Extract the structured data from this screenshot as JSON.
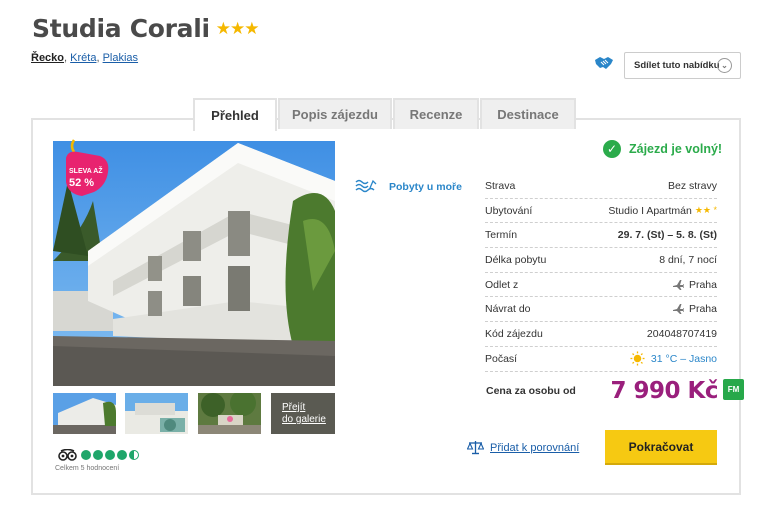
{
  "hotel": {
    "name": "Studia Corali",
    "stars": "★★★"
  },
  "breadcrumb": {
    "country": "Řecko",
    "region": "Kréta",
    "city": "Plakias",
    "sep": ", "
  },
  "share": {
    "label": "Sdílet tuto nabídku",
    "chevron": "⌄"
  },
  "tabs": [
    "Přehled",
    "Popis zájezdu",
    "Recenze",
    "Destinace"
  ],
  "badge": {
    "line1": "SLEVA AŽ",
    "line2": "52 %"
  },
  "gallery": {
    "link_line1": "Přejít",
    "link_line2": "do galerie"
  },
  "rating": {
    "count_text": "Celkem 5 hodnocení"
  },
  "trip_type": {
    "label": "Pobyty u moře",
    "icon": "beach-icon"
  },
  "availability": {
    "text": "Zájezd je volný!",
    "check": "✓"
  },
  "facts": [
    {
      "label": "Strava",
      "value": "Bez stravy"
    },
    {
      "label": "Ubytování",
      "value": "Studio I Apartmán",
      "stars": "★★ *"
    },
    {
      "label": "Termín",
      "value": "29. 7. (St) – 5. 8. (St)"
    },
    {
      "label": "Délka pobytu",
      "value": "8 dní, 7 nocí"
    },
    {
      "label": "Odlet z",
      "value": "Praha"
    },
    {
      "label": "Návrat do",
      "value": "Praha"
    },
    {
      "label": "Kód zájezdu",
      "value": "204048707419"
    },
    {
      "label": "Počasí",
      "value": "31 °C – Jasno"
    }
  ],
  "price": {
    "label": "Cena za osobu od",
    "value": "7 990 Kč",
    "badge": "FM"
  },
  "compare": {
    "label": "Přidat k porovnání"
  },
  "continue": {
    "label": "Pokračovat"
  },
  "colors": {
    "accent_purple": "#9a1f7c",
    "cta_yellow": "#f6c912",
    "ok_green": "#2bab4b",
    "link_blue": "#1a5ea8"
  }
}
